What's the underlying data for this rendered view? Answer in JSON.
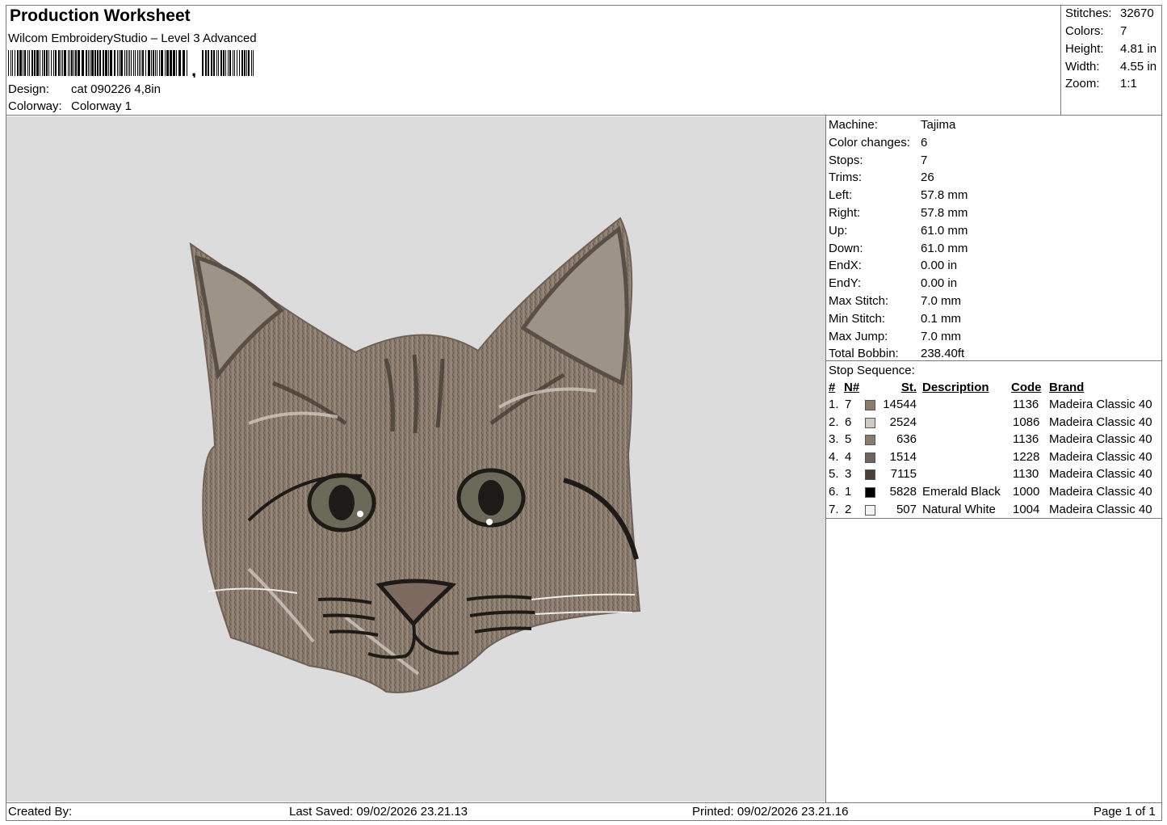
{
  "header": {
    "title": "Production Worksheet",
    "software": "Wilcom EmbroideryStudio – Level 3 Advanced",
    "barcode_suffix": ",",
    "design_label": "Design:",
    "design_value": "cat 090226 4,8in",
    "colorway_label": "Colorway:",
    "colorway_value": "Colorway 1"
  },
  "summary": [
    {
      "label": "Stitches:",
      "value": "32670"
    },
    {
      "label": "Colors:",
      "value": "7"
    },
    {
      "label": "Height:",
      "value": "4.81 in"
    },
    {
      "label": "Width:",
      "value": "4.55 in"
    },
    {
      "label": "Zoom:",
      "value": "1:1"
    }
  ],
  "machine_info": [
    {
      "label": "Machine:",
      "value": "Tajima"
    },
    {
      "label": "Color changes:",
      "value": "6"
    },
    {
      "label": "Stops:",
      "value": "7"
    },
    {
      "label": "Trims:",
      "value": "26"
    },
    {
      "label": "Left:",
      "value": "57.8 mm"
    },
    {
      "label": "Right:",
      "value": "57.8 mm"
    },
    {
      "label": "Up:",
      "value": "61.0 mm"
    },
    {
      "label": "Down:",
      "value": "61.0 mm"
    },
    {
      "label": "EndX:",
      "value": "0.00 in"
    },
    {
      "label": "EndY:",
      "value": "0.00 in"
    },
    {
      "label": "Max Stitch:",
      "value": "7.0 mm"
    },
    {
      "label": "Min Stitch:",
      "value": "0.1 mm"
    },
    {
      "label": "Max Jump:",
      "value": "7.0 mm"
    },
    {
      "label": "Total Bobbin:",
      "value": "238.40ft"
    }
  ],
  "stop_sequence": {
    "title": "Stop Sequence:",
    "headers": {
      "num": "#",
      "n": "N#",
      "st": "St.",
      "description": "Description",
      "code": "Code",
      "brand": "Brand"
    },
    "rows": [
      {
        "num": "1.",
        "n": "7",
        "color": "#8a7b6d",
        "st": "14544",
        "description": "",
        "code": "1136",
        "brand": "Madeira Classic 40"
      },
      {
        "num": "2.",
        "n": "6",
        "color": "#cfcac3",
        "st": "2524",
        "description": "",
        "code": "1086",
        "brand": "Madeira Classic 40"
      },
      {
        "num": "3.",
        "n": "5",
        "color": "#8a7b6d",
        "st": "636",
        "description": "",
        "code": "1136",
        "brand": "Madeira Classic 40"
      },
      {
        "num": "4.",
        "n": "4",
        "color": "#6e665e",
        "st": "1514",
        "description": "",
        "code": "1228",
        "brand": "Madeira Classic 40"
      },
      {
        "num": "5.",
        "n": "3",
        "color": "#4a3f38",
        "st": "7115",
        "description": "",
        "code": "1130",
        "brand": "Madeira Classic 40"
      },
      {
        "num": "6.",
        "n": "1",
        "color": "#000000",
        "st": "5828",
        "description": "Emerald Black",
        "code": "1000",
        "brand": "Madeira Classic 40"
      },
      {
        "num": "7.",
        "n": "2",
        "color": "#f4f4f4",
        "st": "507",
        "description": "Natural White",
        "code": "1004",
        "brand": "Madeira Classic 40"
      }
    ]
  },
  "footer": {
    "created_by": "Created By:",
    "last_saved": "Last Saved: 09/02/2026 23.21.13",
    "printed": "Printed: 09/02/2026 23.21.16",
    "page": "Page 1 of 1"
  },
  "colors": {
    "canvas_bg": "#dcdcdc",
    "fur_mid": "#8a7b6d",
    "fur_light": "#cfcac3",
    "fur_dark": "#4a3f38",
    "outline": "#1e1a17",
    "eye": "#6b6a58"
  }
}
